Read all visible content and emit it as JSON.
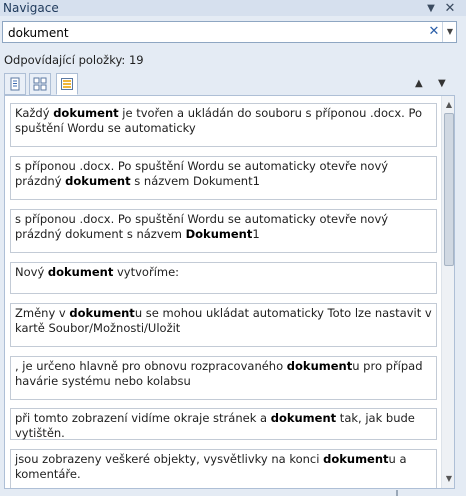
{
  "pane": {
    "title": "Navigace",
    "menu_glyph": "▼",
    "close_glyph": "✕"
  },
  "search": {
    "value": "dokument",
    "clear_glyph": "✕",
    "dropdown_glyph": "▼"
  },
  "results_count_label": "Odpovídající položky: 19",
  "nav": {
    "prev_glyph": "▲",
    "next_glyph": "▼"
  },
  "scroll": {
    "up_glyph": "▲",
    "down_glyph": "▼"
  },
  "results": [
    {
      "parts": [
        [
          "Každý ",
          false
        ],
        [
          "dokument",
          true
        ],
        [
          " je tvořen a ukládán do souboru s příponou .docx. Po spuštění Wordu se automaticky",
          false
        ]
      ]
    },
    {
      "parts": [
        [
          "s příponou .docx. Po spuštění Wordu se automaticky otevře nový prázdný ",
          false
        ],
        [
          "dokument",
          true
        ],
        [
          " s názvem Dokument1",
          false
        ]
      ]
    },
    {
      "parts": [
        [
          "s příponou .docx. Po spuštění Wordu se automaticky otevře nový prázdný dokument s názvem ",
          false
        ],
        [
          "Dokument",
          true
        ],
        [
          "1",
          false
        ]
      ]
    },
    {
      "parts": [
        [
          "Nový ",
          false
        ],
        [
          "dokument",
          true
        ],
        [
          " vytvoříme:",
          false
        ]
      ]
    },
    {
      "parts": [
        [
          "Změny v ",
          false
        ],
        [
          "dokument",
          true
        ],
        [
          "u se mohou ukládat automaticky Toto lze nastavit v kartě Soubor/Možnosti/Uložit",
          false
        ]
      ]
    },
    {
      "parts": [
        [
          ", je určeno hlavně pro obnovu rozpracovaného ",
          false
        ],
        [
          "dokument",
          true
        ],
        [
          "u pro případ havárie systému nebo kolabsu",
          false
        ]
      ]
    },
    {
      "parts": [
        [
          "při tomto zobrazení vidíme okraje stránek a ",
          false
        ],
        [
          "dokument",
          true
        ],
        [
          " tak, jak bude vytištěn.",
          false
        ]
      ]
    },
    {
      "parts": [
        [
          "jsou zobrazeny veškeré objekty, vysvětlivky na konci ",
          false
        ],
        [
          "dokument",
          true
        ],
        [
          "u a komentáře.",
          false
        ]
      ]
    }
  ]
}
